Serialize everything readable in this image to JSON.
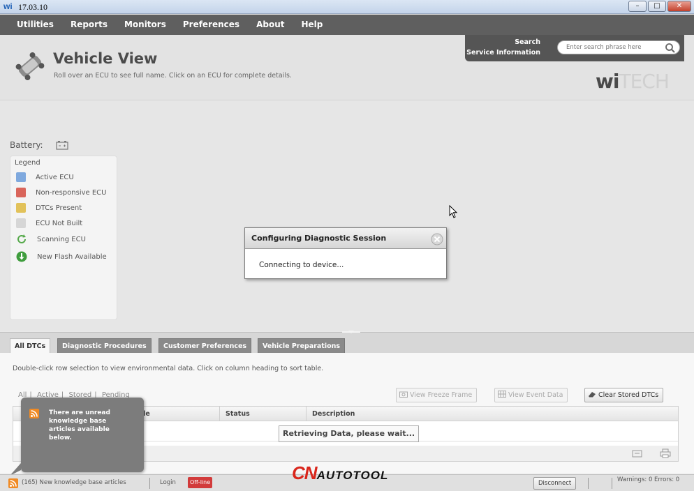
{
  "window": {
    "app_icon": "wi",
    "title": "17.03.10",
    "buttons": [
      "minimize",
      "maximize",
      "close"
    ]
  },
  "menu": [
    "Utilities",
    "Reports",
    "Monitors",
    "Preferences",
    "About",
    "Help"
  ],
  "header": {
    "title": "Vehicle View",
    "subtitle": "Roll over an ECU to see full name. Click on an ECU for complete details.",
    "search_label_line1": "Search",
    "search_label_line2": "Service Information",
    "search_placeholder": "Enter search phrase here",
    "logo_dark": "wi",
    "logo_light": "TECH"
  },
  "main": {
    "battery_label": "Battery:",
    "legend_title": "Legend",
    "legend": [
      {
        "label": "Active ECU",
        "color": "#7fa9de"
      },
      {
        "label": "Non-responsive ECU",
        "color": "#d9655b"
      },
      {
        "label": "DTCs Present",
        "color": "#e2c25a"
      },
      {
        "label": "ECU Not Built",
        "color": "#d6d6d6"
      },
      {
        "label": "Scanning ECU",
        "icon": "refresh-icon"
      },
      {
        "label": "New Flash Available",
        "icon": "flash-download-icon"
      }
    ]
  },
  "dialog": {
    "title": "Configuring Diagnostic Session",
    "message": "Connecting to device..."
  },
  "tabs": [
    "All DTCs",
    "Diagnostic Procedures",
    "Customer Preferences",
    "Vehicle Preparations"
  ],
  "dtc": {
    "instructions": "Double-click row selection to view environmental data.  Click on column heading to sort table.",
    "filters": [
      "All",
      "Active",
      "Stored",
      "Pending"
    ],
    "buttons": {
      "freeze": "View Freeze Frame",
      "event": "View Event Data",
      "clear": "Clear Stored DTCs"
    },
    "columns": [
      "ode",
      "Status",
      "Description"
    ],
    "retrieving": "Retrieving Data, please wait..."
  },
  "kb_popup": {
    "text": "There are unread knowledge base articles available below."
  },
  "status": {
    "kb_articles": "(165) New knowledge base articles",
    "login": "Login",
    "offline": "Off-line",
    "disconnect": "Disconnect",
    "warnings": "Warnings: 0 Errors: 0"
  },
  "watermark": {
    "big": "CN",
    "small": "AUTOTOOL"
  }
}
